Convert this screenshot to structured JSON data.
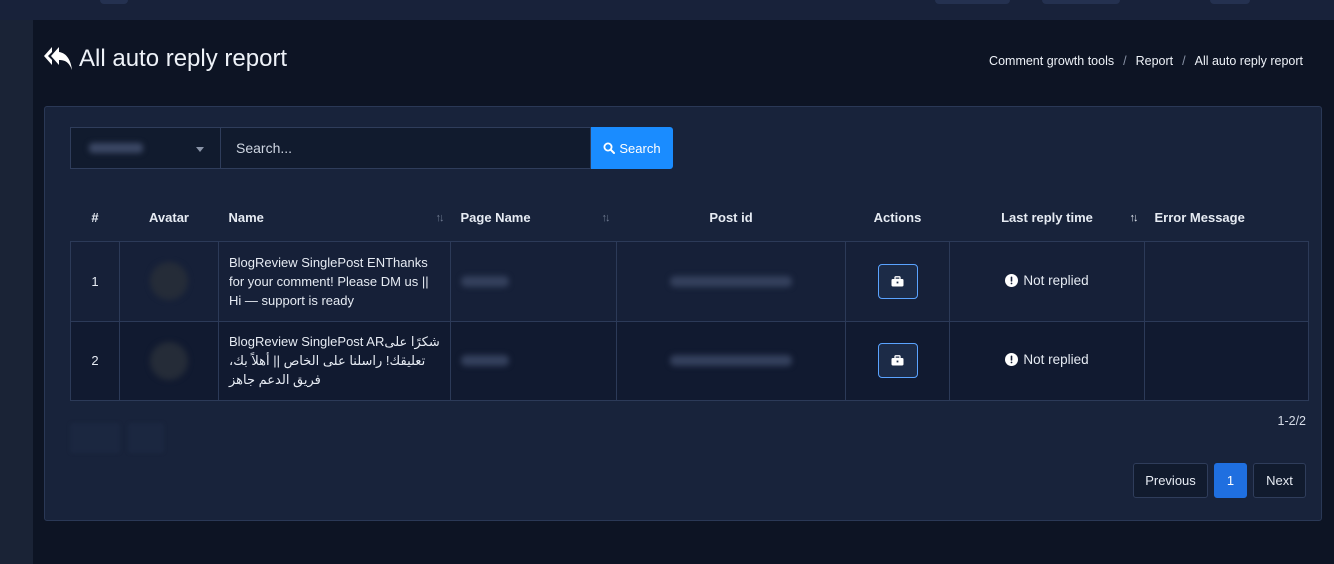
{
  "header": {
    "title": "All auto reply report",
    "breadcrumb": [
      "Comment growth tools",
      "Report",
      "All auto reply report"
    ]
  },
  "search": {
    "placeholder": "Search...",
    "button_label": "Search"
  },
  "table": {
    "columns": [
      "#",
      "Avatar",
      "Name",
      "Page Name",
      "Post id",
      "Actions",
      "Last reply time",
      "Error Message"
    ],
    "rows": [
      {
        "index": "1",
        "name": "BlogReview SinglePost ENThanks for your comment! Please DM us || Hi — support is ready",
        "status": "Not replied",
        "error": ""
      },
      {
        "index": "2",
        "name": "BlogReview SinglePost ARشكرًا على تعليقك! راسلنا على الخاص || أهلاً بك، فريق الدعم جاهز",
        "status": "Not replied",
        "error": ""
      }
    ]
  },
  "footer": {
    "count": "1-2/2"
  },
  "pagination": {
    "previous": "Previous",
    "current": "1",
    "next": "Next"
  },
  "colors": {
    "background": "#0d1424",
    "card": "#18233b",
    "accent": "#1a8cff",
    "active_page": "#1f6fe0",
    "action_border": "#5aa3ff"
  }
}
